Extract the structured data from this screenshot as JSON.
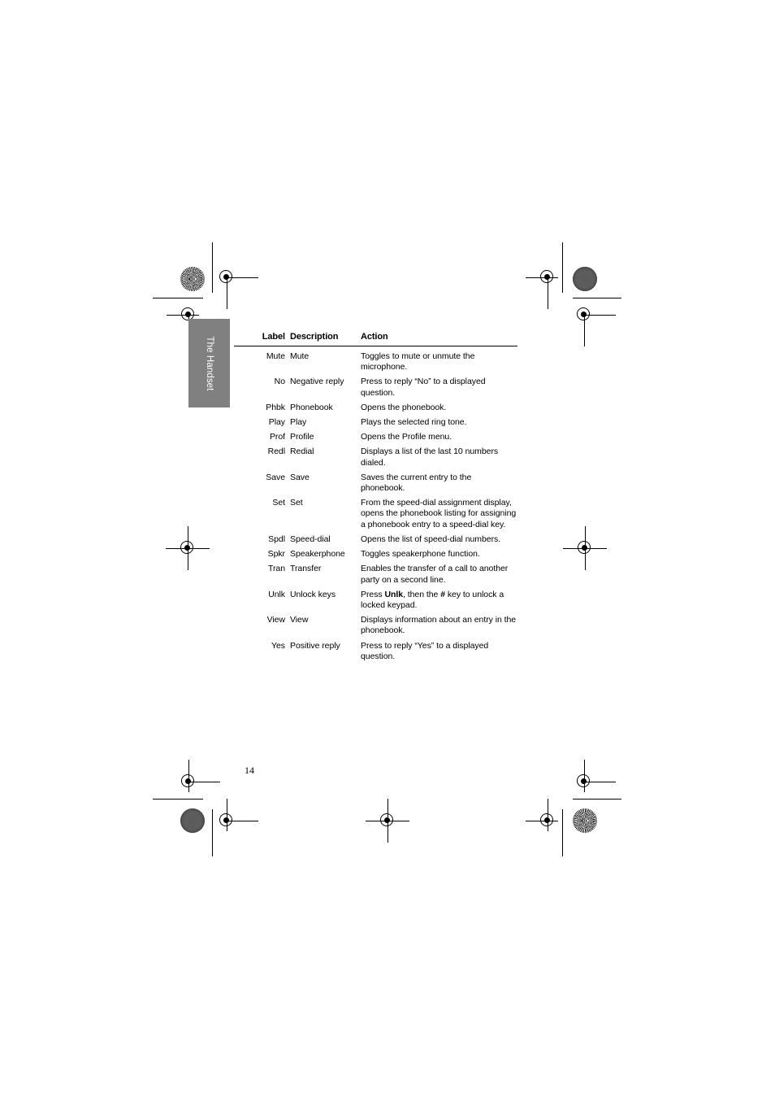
{
  "page": {
    "folio": "14",
    "side_tab_label": "The Handset",
    "tab_color": "#808080"
  },
  "table": {
    "headers": {
      "label": "Label",
      "description": "Description",
      "action": "Action"
    },
    "rows": [
      {
        "label": "Mute",
        "description": "Mute",
        "action": "Toggles to mute or unmute the microphone."
      },
      {
        "label": "No",
        "description": "Negative reply",
        "action": "Press to reply “No” to a displayed question."
      },
      {
        "label": "Phbk",
        "description": "Phonebook",
        "action": "Opens the phonebook."
      },
      {
        "label": "Play",
        "description": "Play",
        "action": "Plays the selected ring tone."
      },
      {
        "label": "Prof",
        "description": "Profile",
        "action": "Opens the Profile menu."
      },
      {
        "label": "Redl",
        "description": "Redial",
        "action": "Displays a list of the last 10 numbers dialed."
      },
      {
        "label": "Save",
        "description": "Save",
        "action": "Saves the current entry to the phonebook."
      },
      {
        "label": "Set",
        "description": "Set",
        "action": "From the speed-dial assignment display, opens the phonebook listing for assigning a phonebook entry to a speed-dial key."
      },
      {
        "label": "Spdl",
        "description": "Speed-dial",
        "action": "Opens the list of speed-dial numbers."
      },
      {
        "label": "Spkr",
        "description": "Speakerphone",
        "action": "Toggles speakerphone function."
      },
      {
        "label": "Tran",
        "description": "Transfer",
        "action": "Enables the transfer of a call to another party on a second line."
      },
      {
        "label": "Unlk",
        "description": "Unlock keys",
        "action_parts": [
          {
            "text": "Press ",
            "bold": false
          },
          {
            "text": "Unlk",
            "bold": true
          },
          {
            "text": ", then the ",
            "bold": false
          },
          {
            "text": "#",
            "bold": true
          },
          {
            "text": " key to unlock a locked keypad.",
            "bold": false
          }
        ],
        "action": "Press Unlk, then the # key to unlock a locked keypad."
      },
      {
        "label": "View",
        "description": "View",
        "action": "Displays information about an entry in the phonebook."
      },
      {
        "label": "Yes",
        "description": "Positive reply",
        "action": "Press to reply “Yes” to a displayed question."
      }
    ]
  }
}
